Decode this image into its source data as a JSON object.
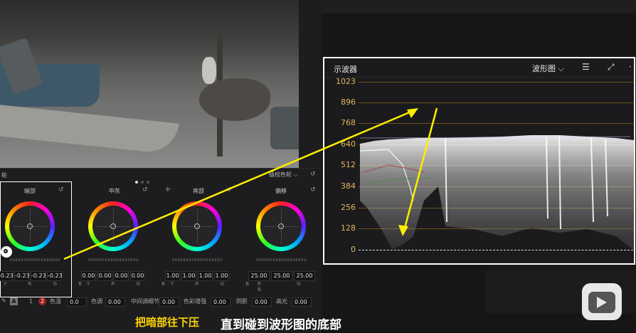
{
  "color_panel": {
    "title": "轮",
    "mode": "级校色轮 ⌵",
    "wheels": [
      {
        "label": "暗部",
        "values": [
          "-0.23",
          "-0.23",
          "-0.23",
          "-0.23"
        ]
      },
      {
        "label": "中灰",
        "values": [
          "0.00",
          "0.00",
          "0.00",
          "0.00"
        ]
      },
      {
        "label": "亮部",
        "values": [
          "1.00",
          "1.00",
          "1.00",
          "1.00"
        ]
      },
      {
        "label": "偏移",
        "values": [
          "25.00",
          "25.00",
          "25.00"
        ]
      }
    ],
    "channels_ymrgb": "Y R G B",
    "channels_rgb": "R G B",
    "bottom": {
      "tool": "A",
      "page1": "1",
      "page2": "2",
      "temp_label": "色温",
      "temp_value": "0.0",
      "tint_label": "色调",
      "tint_value": "0.00",
      "midtone_label": "中间调细节",
      "midtone_value": "0.00",
      "boost_label": "色彩增强",
      "boost_value": "0.00",
      "shadow_label": "阴影",
      "shadow_value": "0.00",
      "hl_label": "高光",
      "hl_value": "0.00"
    }
  },
  "scope": {
    "title": "示波器",
    "mode": "波形图",
    "ticks": [
      "1023",
      "896",
      "768",
      "640",
      "512",
      "384",
      "256",
      "128",
      "0"
    ]
  },
  "subtitle": {
    "part1": "把暗部往下压",
    "part2": "直到碰到波形图的底部"
  },
  "colors": {
    "accent": "#ffd400",
    "tick": "#e3b45a",
    "arrow": "#ffee00"
  }
}
